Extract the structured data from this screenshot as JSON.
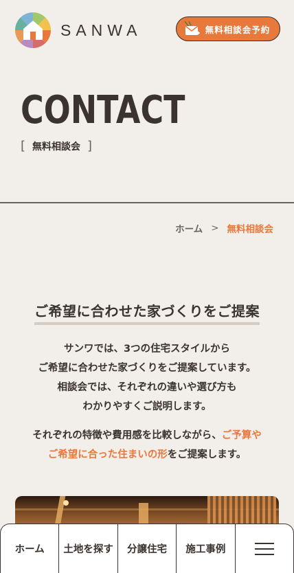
{
  "header": {
    "logo_text": "SANWA",
    "cta_label": "無料相談会予約"
  },
  "hero": {
    "title": "CONTACT",
    "bracket_open": "[",
    "subtitle": "無料相談会",
    "bracket_close": "]"
  },
  "breadcrumb": {
    "home": "ホーム",
    "separator": ">",
    "current": "無料相談会"
  },
  "section": {
    "heading": "ご希望に合わせた家づくりをご提案",
    "paragraph1": [
      "サンワでは、3つの住宅スタイルから",
      "ご希望に合わせた家づくりをご提案しています。",
      "相談会では、それぞれの違いや選び方も",
      "わかりやすくご説明します。"
    ],
    "paragraph2_plain1": "それぞれの特徴や費用感を比較しながら、",
    "paragraph2_accent1": "ご予算や",
    "paragraph2_accent2": "ご希望に合った住まいの形",
    "paragraph2_plain2": "をご提案します。"
  },
  "bottom_nav": {
    "items": [
      "ホーム",
      "土地を探す",
      "分譲住宅",
      "施工事例"
    ],
    "menu_icon": "hamburger-icon"
  },
  "colors": {
    "accent": "#e8793c",
    "background": "#f2efea",
    "text": "#3a3330"
  }
}
